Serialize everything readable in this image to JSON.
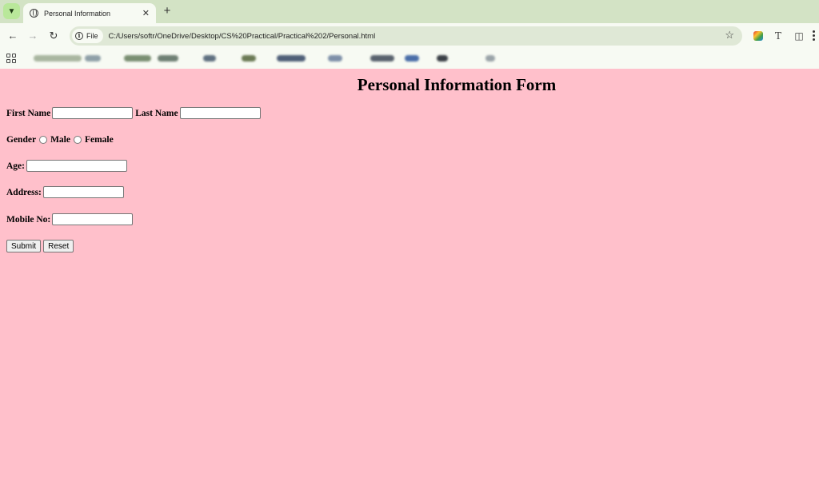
{
  "browser": {
    "tab_title": "Personal Information",
    "file_label": "File",
    "url": "C:/Users/softr/OneDrive/Desktop/CS%20Practical/Practical%202/Personal.html"
  },
  "form": {
    "heading": "Personal Information Form",
    "first_name_label": "First Name",
    "first_name_value": "",
    "last_name_label": "Last Name",
    "last_name_value": "",
    "gender_label": "Gender",
    "gender_options": [
      "Male",
      "Female"
    ],
    "age_label": "Age:",
    "age_value": "",
    "address_label": "Address:",
    "address_value": "",
    "mobile_label": "Mobile No:",
    "mobile_value": "",
    "submit_label": "Submit",
    "reset_label": "Reset"
  },
  "colors": {
    "page_background": "#ffc0cb",
    "tabstrip": "#d3e3c5",
    "toolbar": "#f7faf3"
  }
}
